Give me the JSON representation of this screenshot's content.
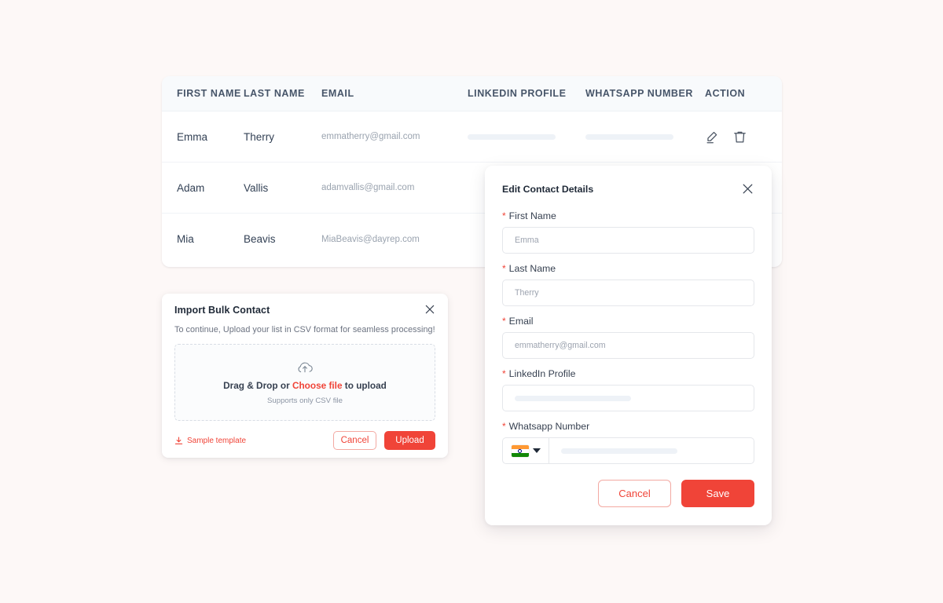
{
  "table": {
    "columns": [
      {
        "key": "first_name",
        "label": "FIRST NAME"
      },
      {
        "key": "last_name",
        "label": "LAST NAME"
      },
      {
        "key": "email",
        "label": "EMAIL"
      },
      {
        "key": "linkedin",
        "label": "LINKEDIN PROFILE"
      },
      {
        "key": "whatsapp",
        "label": "WHATSAPP NUMBER"
      },
      {
        "key": "action",
        "label": "ACTION"
      }
    ],
    "rows": [
      {
        "first_name": "Emma",
        "last_name": "Therry",
        "email": "emmatherry@gmail.com",
        "linkedin": "",
        "whatsapp": "",
        "actions": [
          "edit-icon",
          "delete-icon"
        ]
      },
      {
        "first_name": "Adam",
        "last_name": "Vallis",
        "email": "adamvallis@gmail.com",
        "linkedin": "",
        "whatsapp": "",
        "actions": []
      },
      {
        "first_name": "Mia",
        "last_name": "Beavis",
        "email": "MiaBeavis@dayrep.com",
        "linkedin": "",
        "whatsapp": "",
        "actions": []
      }
    ]
  },
  "import_dialog": {
    "title": "Import Bulk Contact",
    "subtitle": "To continue, Upload your list in CSV format for seamless processing!",
    "close_icon": "close-icon",
    "dropzone": {
      "icon": "cloud-upload-icon",
      "text_before": "Drag & Drop or ",
      "link_text": "Choose file",
      "text_after": " to upload",
      "hint": "Supports only CSV file"
    },
    "sample_template_label": "Sample template",
    "sample_template_icon": "download-icon",
    "cancel_label": "Cancel",
    "upload_label": "Upload"
  },
  "edit_modal": {
    "title": "Edit Contact Details",
    "close_icon": "close-icon",
    "fields": [
      {
        "label": "First Name",
        "required": "*",
        "value": "Emma",
        "type": "text"
      },
      {
        "label": "Last Name",
        "required": "*",
        "value": "Therry",
        "type": "text"
      },
      {
        "label": "Email",
        "required": "*",
        "value": "emmatherry@gmail.com",
        "type": "text"
      },
      {
        "label": "LinkedIn Profile",
        "required": "*",
        "value": "",
        "type": "skeleton"
      },
      {
        "label": "Whatsapp Number",
        "required": "*",
        "value": "",
        "type": "phone"
      }
    ],
    "country_flag": "india-flag-icon",
    "country_caret": "chevron-down-icon",
    "cancel_label": "Cancel",
    "save_label": "Save"
  },
  "colors": {
    "page_background": "#fdf8f7",
    "accent_red": "#f04438",
    "header_background": "#f8fafc",
    "header_text": "#475569",
    "skeleton": "#eef2f7"
  }
}
